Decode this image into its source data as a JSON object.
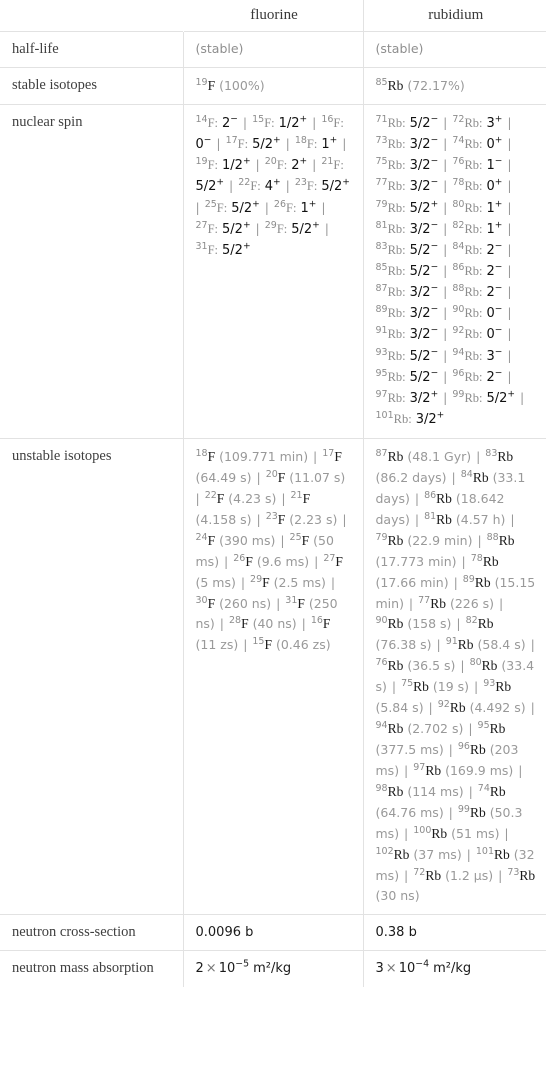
{
  "table": {
    "columns": [
      "",
      "fluorine",
      "rubidium"
    ],
    "rows": [
      {
        "label": "half-life",
        "fluorine": "(stable)",
        "rubidium": "(stable)",
        "style": "muted"
      },
      {
        "label": "stable isotopes",
        "fluorine_isotopes": [
          {
            "mass": "19",
            "element": "F",
            "value": "(100%)"
          }
        ],
        "rubidium_isotopes": [
          {
            "mass": "85",
            "element": "Rb",
            "value": "(72.17%)"
          }
        ]
      },
      {
        "label": "nuclear spin",
        "fluorine_spins": [
          {
            "mass": "14",
            "element": "F",
            "spin": "2",
            "sign": "-"
          },
          {
            "mass": "15",
            "element": "F",
            "spin": "1/2",
            "sign": "+"
          },
          {
            "mass": "16",
            "element": "F",
            "spin": "0",
            "sign": "-"
          },
          {
            "mass": "17",
            "element": "F",
            "spin": "5/2",
            "sign": "+"
          },
          {
            "mass": "18",
            "element": "F",
            "spin": "1",
            "sign": "+"
          },
          {
            "mass": "19",
            "element": "F",
            "spin": "1/2",
            "sign": "+"
          },
          {
            "mass": "20",
            "element": "F",
            "spin": "2",
            "sign": "+"
          },
          {
            "mass": "21",
            "element": "F",
            "spin": "5/2",
            "sign": "+"
          },
          {
            "mass": "22",
            "element": "F",
            "spin": "4",
            "sign": "+"
          },
          {
            "mass": "23",
            "element": "F",
            "spin": "5/2",
            "sign": "+"
          },
          {
            "mass": "25",
            "element": "F",
            "spin": "5/2",
            "sign": "+"
          },
          {
            "mass": "26",
            "element": "F",
            "spin": "1",
            "sign": "+"
          },
          {
            "mass": "27",
            "element": "F",
            "spin": "5/2",
            "sign": "+"
          },
          {
            "mass": "29",
            "element": "F",
            "spin": "5/2",
            "sign": "+"
          },
          {
            "mass": "31",
            "element": "F",
            "spin": "5/2",
            "sign": "+"
          }
        ],
        "rubidium_spins": [
          {
            "mass": "71",
            "element": "Rb",
            "spin": "5/2",
            "sign": "-"
          },
          {
            "mass": "72",
            "element": "Rb",
            "spin": "3",
            "sign": "+"
          },
          {
            "mass": "73",
            "element": "Rb",
            "spin": "3/2",
            "sign": "-"
          },
          {
            "mass": "74",
            "element": "Rb",
            "spin": "0",
            "sign": "+"
          },
          {
            "mass": "75",
            "element": "Rb",
            "spin": "3/2",
            "sign": "-"
          },
          {
            "mass": "76",
            "element": "Rb",
            "spin": "1",
            "sign": "-"
          },
          {
            "mass": "77",
            "element": "Rb",
            "spin": "3/2",
            "sign": "-"
          },
          {
            "mass": "78",
            "element": "Rb",
            "spin": "0",
            "sign": "+"
          },
          {
            "mass": "79",
            "element": "Rb",
            "spin": "5/2",
            "sign": "+"
          },
          {
            "mass": "80",
            "element": "Rb",
            "spin": "1",
            "sign": "+"
          },
          {
            "mass": "81",
            "element": "Rb",
            "spin": "3/2",
            "sign": "-"
          },
          {
            "mass": "82",
            "element": "Rb",
            "spin": "1",
            "sign": "+"
          },
          {
            "mass": "83",
            "element": "Rb",
            "spin": "5/2",
            "sign": "-"
          },
          {
            "mass": "84",
            "element": "Rb",
            "spin": "2",
            "sign": "-"
          },
          {
            "mass": "85",
            "element": "Rb",
            "spin": "5/2",
            "sign": "-"
          },
          {
            "mass": "86",
            "element": "Rb",
            "spin": "2",
            "sign": "-"
          },
          {
            "mass": "87",
            "element": "Rb",
            "spin": "3/2",
            "sign": "-"
          },
          {
            "mass": "88",
            "element": "Rb",
            "spin": "2",
            "sign": "-"
          },
          {
            "mass": "89",
            "element": "Rb",
            "spin": "3/2",
            "sign": "-"
          },
          {
            "mass": "90",
            "element": "Rb",
            "spin": "0",
            "sign": "-"
          },
          {
            "mass": "91",
            "element": "Rb",
            "spin": "3/2",
            "sign": "-"
          },
          {
            "mass": "92",
            "element": "Rb",
            "spin": "0",
            "sign": "-"
          },
          {
            "mass": "93",
            "element": "Rb",
            "spin": "5/2",
            "sign": "-"
          },
          {
            "mass": "94",
            "element": "Rb",
            "spin": "3",
            "sign": "-"
          },
          {
            "mass": "95",
            "element": "Rb",
            "spin": "5/2",
            "sign": "-"
          },
          {
            "mass": "96",
            "element": "Rb",
            "spin": "2",
            "sign": "-"
          },
          {
            "mass": "97",
            "element": "Rb",
            "spin": "3/2",
            "sign": "+"
          },
          {
            "mass": "99",
            "element": "Rb",
            "spin": "5/2",
            "sign": "+"
          },
          {
            "mass": "101",
            "element": "Rb",
            "spin": "3/2",
            "sign": "+"
          }
        ]
      },
      {
        "label": "unstable isotopes",
        "fluorine_unstable": [
          {
            "mass": "18",
            "element": "F",
            "halflife": "(109.771 min)"
          },
          {
            "mass": "17",
            "element": "F",
            "halflife": "(64.49 s)"
          },
          {
            "mass": "20",
            "element": "F",
            "halflife": "(11.07 s)"
          },
          {
            "mass": "22",
            "element": "F",
            "halflife": "(4.23 s)"
          },
          {
            "mass": "21",
            "element": "F",
            "halflife": "(4.158 s)"
          },
          {
            "mass": "23",
            "element": "F",
            "halflife": "(2.23 s)"
          },
          {
            "mass": "24",
            "element": "F",
            "halflife": "(390 ms)"
          },
          {
            "mass": "25",
            "element": "F",
            "halflife": "(50 ms)"
          },
          {
            "mass": "26",
            "element": "F",
            "halflife": "(9.6 ms)"
          },
          {
            "mass": "27",
            "element": "F",
            "halflife": "(5 ms)"
          },
          {
            "mass": "29",
            "element": "F",
            "halflife": "(2.5 ms)"
          },
          {
            "mass": "30",
            "element": "F",
            "halflife": "(260 ns)"
          },
          {
            "mass": "31",
            "element": "F",
            "halflife": "(250 ns)"
          },
          {
            "mass": "28",
            "element": "F",
            "halflife": "(40 ns)"
          },
          {
            "mass": "16",
            "element": "F",
            "halflife": "(11 zs)"
          },
          {
            "mass": "15",
            "element": "F",
            "halflife": "(0.46 zs)"
          }
        ],
        "rubidium_unstable": [
          {
            "mass": "87",
            "element": "Rb",
            "halflife": "(48.1 Gyr)"
          },
          {
            "mass": "83",
            "element": "Rb",
            "halflife": "(86.2 days)"
          },
          {
            "mass": "84",
            "element": "Rb",
            "halflife": "(33.1 days)"
          },
          {
            "mass": "86",
            "element": "Rb",
            "halflife": "(18.642 days)"
          },
          {
            "mass": "81",
            "element": "Rb",
            "halflife": "(4.57 h)"
          },
          {
            "mass": "79",
            "element": "Rb",
            "halflife": "(22.9 min)"
          },
          {
            "mass": "88",
            "element": "Rb",
            "halflife": "(17.773 min)"
          },
          {
            "mass": "78",
            "element": "Rb",
            "halflife": "(17.66 min)"
          },
          {
            "mass": "89",
            "element": "Rb",
            "halflife": "(15.15 min)"
          },
          {
            "mass": "77",
            "element": "Rb",
            "halflife": "(226 s)"
          },
          {
            "mass": "90",
            "element": "Rb",
            "halflife": "(158 s)"
          },
          {
            "mass": "82",
            "element": "Rb",
            "halflife": "(76.38 s)"
          },
          {
            "mass": "91",
            "element": "Rb",
            "halflife": "(58.4 s)"
          },
          {
            "mass": "76",
            "element": "Rb",
            "halflife": "(36.5 s)"
          },
          {
            "mass": "80",
            "element": "Rb",
            "halflife": "(33.4 s)"
          },
          {
            "mass": "75",
            "element": "Rb",
            "halflife": "(19 s)"
          },
          {
            "mass": "93",
            "element": "Rb",
            "halflife": "(5.84 s)"
          },
          {
            "mass": "92",
            "element": "Rb",
            "halflife": "(4.492 s)"
          },
          {
            "mass": "94",
            "element": "Rb",
            "halflife": "(2.702 s)"
          },
          {
            "mass": "95",
            "element": "Rb",
            "halflife": "(377.5 ms)"
          },
          {
            "mass": "96",
            "element": "Rb",
            "halflife": "(203 ms)"
          },
          {
            "mass": "97",
            "element": "Rb",
            "halflife": "(169.9 ms)"
          },
          {
            "mass": "98",
            "element": "Rb",
            "halflife": "(114 ms)"
          },
          {
            "mass": "74",
            "element": "Rb",
            "halflife": "(64.76 ms)"
          },
          {
            "mass": "99",
            "element": "Rb",
            "halflife": "(50.3 ms)"
          },
          {
            "mass": "100",
            "element": "Rb",
            "halflife": "(51 ms)"
          },
          {
            "mass": "102",
            "element": "Rb",
            "halflife": "(37 ms)"
          },
          {
            "mass": "101",
            "element": "Rb",
            "halflife": "(32 ms)"
          },
          {
            "mass": "72",
            "element": "Rb",
            "halflife": "(1.2 µs)"
          },
          {
            "mass": "73",
            "element": "Rb",
            "halflife": "(30 ns)"
          }
        ]
      },
      {
        "label": "neutron cross-section",
        "fluorine": "0.0096 b",
        "rubidium": "0.38 b"
      },
      {
        "label": "neutron mass absorption",
        "fluorine_sci": {
          "mantissa": "2",
          "times": "×",
          "base": "10",
          "exponent": "-5",
          "unit": "m²/kg"
        },
        "rubidium_sci": {
          "mantissa": "3",
          "times": "×",
          "base": "10",
          "exponent": "-4",
          "unit": "m²/kg"
        }
      }
    ]
  },
  "separator": "|"
}
